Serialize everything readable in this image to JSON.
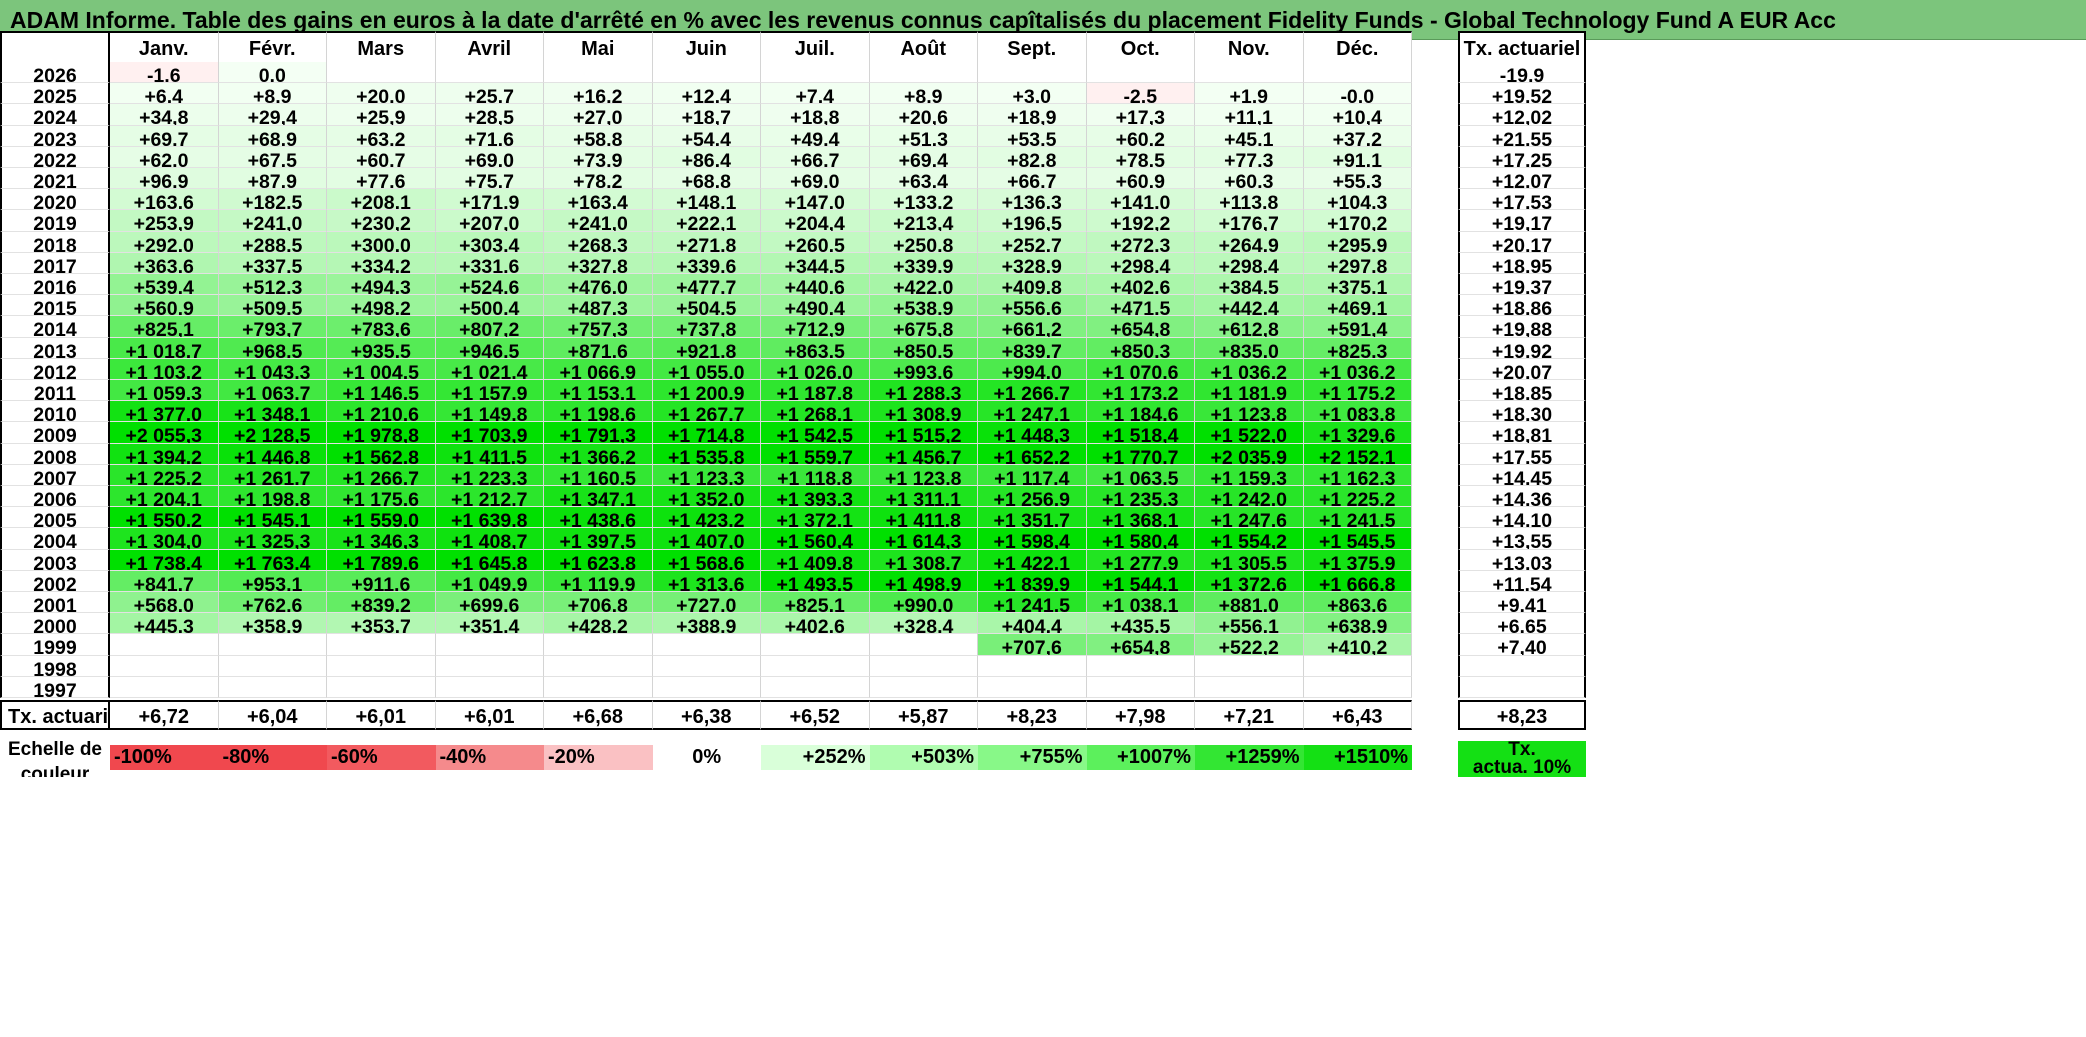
{
  "title": "ADAM Informe. Table des gains en euros à la date d'arrêté en % avec les revenus connus capîtalisés du placement Fidelity Funds - Global Technology Fund A EUR Acc",
  "months": [
    "Janv.",
    "Févr.",
    "Mars",
    "Avril",
    "Mai",
    "Juin",
    "Juil.",
    "Août",
    "Sept.",
    "Oct.",
    "Nov.",
    "Déc."
  ],
  "tx_header": "Tx. actuariel",
  "rows": [
    {
      "year": "2026",
      "values": [
        "-1,6",
        "0,0",
        "",
        "",
        "",
        "",
        "",
        "",
        "",
        "",
        "",
        ""
      ],
      "tx": "-19,9"
    },
    {
      "year": "2025",
      "values": [
        "+6,4",
        "+8,9",
        "+20,0",
        "+25,7",
        "+16,2",
        "+12,4",
        "+7,4",
        "+8,9",
        "+3,0",
        "-2,5",
        "+1,9",
        "-0,0"
      ],
      "tx": "+19,52"
    },
    {
      "year": "2024",
      "values": [
        "+34,8",
        "+29,4",
        "+25,9",
        "+28,5",
        "+27,0",
        "+18,7",
        "+18,8",
        "+20,6",
        "+18,9",
        "+17,3",
        "+11,1",
        "+10,4"
      ],
      "tx": "+12,02"
    },
    {
      "year": "2023",
      "values": [
        "+69,7",
        "+68,9",
        "+63,2",
        "+71,6",
        "+58,8",
        "+54,4",
        "+49,4",
        "+51,3",
        "+53,5",
        "+60,2",
        "+45,1",
        "+37,2"
      ],
      "tx": "+21,55"
    },
    {
      "year": "2022",
      "values": [
        "+62,0",
        "+67,5",
        "+60,7",
        "+69,0",
        "+73,9",
        "+86,4",
        "+66,7",
        "+69,4",
        "+82,8",
        "+78,5",
        "+77,3",
        "+91,1"
      ],
      "tx": "+17,25"
    },
    {
      "year": "2021",
      "values": [
        "+96,9",
        "+87,9",
        "+77,6",
        "+75,7",
        "+78,2",
        "+68,8",
        "+69,0",
        "+63,4",
        "+66,7",
        "+60,9",
        "+60,3",
        "+55,3"
      ],
      "tx": "+12,07"
    },
    {
      "year": "2020",
      "values": [
        "+163,6",
        "+182,5",
        "+208,1",
        "+171,9",
        "+163,4",
        "+148,1",
        "+147,0",
        "+133,2",
        "+136,3",
        "+141,0",
        "+113,8",
        "+104,3"
      ],
      "tx": "+17,53"
    },
    {
      "year": "2019",
      "values": [
        "+253,9",
        "+241,0",
        "+230,2",
        "+207,0",
        "+241,0",
        "+222,1",
        "+204,4",
        "+213,4",
        "+196,5",
        "+192,2",
        "+176,7",
        "+170,2"
      ],
      "tx": "+19,17"
    },
    {
      "year": "2018",
      "values": [
        "+292,0",
        "+288,5",
        "+300,0",
        "+303,4",
        "+268,3",
        "+271,8",
        "+260,5",
        "+250,8",
        "+252,7",
        "+272,3",
        "+264,9",
        "+295,9"
      ],
      "tx": "+20,17"
    },
    {
      "year": "2017",
      "values": [
        "+363,6",
        "+337,5",
        "+334,2",
        "+331,6",
        "+327,8",
        "+339,6",
        "+344,5",
        "+339,9",
        "+328,9",
        "+298,4",
        "+298,4",
        "+297,8"
      ],
      "tx": "+18,95"
    },
    {
      "year": "2016",
      "values": [
        "+539,4",
        "+512,3",
        "+494,3",
        "+524,6",
        "+476,0",
        "+477,7",
        "+440,6",
        "+422,0",
        "+409,8",
        "+402,6",
        "+384,5",
        "+375,1"
      ],
      "tx": "+19,37"
    },
    {
      "year": "2015",
      "values": [
        "+560,9",
        "+509,5",
        "+498,2",
        "+500,4",
        "+487,3",
        "+504,5",
        "+490,4",
        "+538,9",
        "+556,6",
        "+471,5",
        "+442,4",
        "+469,1"
      ],
      "tx": "+18,86"
    },
    {
      "year": "2014",
      "values": [
        "+825,1",
        "+793,7",
        "+783,6",
        "+807,2",
        "+757,3",
        "+737,8",
        "+712,9",
        "+675,8",
        "+661,2",
        "+654,8",
        "+612,8",
        "+591,4"
      ],
      "tx": "+19,88"
    },
    {
      "year": "2013",
      "values": [
        "+1 018,7",
        "+968,5",
        "+935,5",
        "+946,5",
        "+871,6",
        "+921,8",
        "+863,5",
        "+850,5",
        "+839,7",
        "+850,3",
        "+835,0",
        "+825,3"
      ],
      "tx": "+19,92"
    },
    {
      "year": "2012",
      "values": [
        "+1 103,2",
        "+1 043,3",
        "+1 004,5",
        "+1 021,4",
        "+1 066,9",
        "+1 055,0",
        "+1 026,0",
        "+993,6",
        "+994,0",
        "+1 070,6",
        "+1 036,2",
        "+1 036,2"
      ],
      "tx": "+20,07"
    },
    {
      "year": "2011",
      "values": [
        "+1 059,3",
        "+1 063,7",
        "+1 146,5",
        "+1 157,9",
        "+1 153,1",
        "+1 200,9",
        "+1 187,8",
        "+1 288,3",
        "+1 266,7",
        "+1 173,2",
        "+1 181,9",
        "+1 175,2"
      ],
      "tx": "+18,85"
    },
    {
      "year": "2010",
      "values": [
        "+1 377,0",
        "+1 348,1",
        "+1 210,6",
        "+1 149,8",
        "+1 198,6",
        "+1 267,7",
        "+1 268,1",
        "+1 308,9",
        "+1 247,1",
        "+1 184,6",
        "+1 123,8",
        "+1 083,8"
      ],
      "tx": "+18,30"
    },
    {
      "year": "2009",
      "values": [
        "+2 055,3",
        "+2 128,5",
        "+1 978,8",
        "+1 703,9",
        "+1 791,3",
        "+1 714,8",
        "+1 542,5",
        "+1 515,2",
        "+1 448,3",
        "+1 518,4",
        "+1 522,0",
        "+1 329,6"
      ],
      "tx": "+18,81"
    },
    {
      "year": "2008",
      "values": [
        "+1 394,2",
        "+1 446,8",
        "+1 562,8",
        "+1 411,5",
        "+1 366,2",
        "+1 535,8",
        "+1 559,7",
        "+1 456,7",
        "+1 652,2",
        "+1 770,7",
        "+2 035,9",
        "+2 152,1"
      ],
      "tx": "+17,55"
    },
    {
      "year": "2007",
      "values": [
        "+1 225,2",
        "+1 261,7",
        "+1 266,7",
        "+1 223,3",
        "+1 160,5",
        "+1 123,3",
        "+1 118,8",
        "+1 123,8",
        "+1 117,4",
        "+1 063,5",
        "+1 159,3",
        "+1 162,3"
      ],
      "tx": "+14,45"
    },
    {
      "year": "2006",
      "values": [
        "+1 204,1",
        "+1 198,8",
        "+1 175,6",
        "+1 212,7",
        "+1 347,1",
        "+1 352,0",
        "+1 393,3",
        "+1 311,1",
        "+1 256,9",
        "+1 235,3",
        "+1 242,0",
        "+1 225,2"
      ],
      "tx": "+14,36"
    },
    {
      "year": "2005",
      "values": [
        "+1 550,2",
        "+1 545,1",
        "+1 559,0",
        "+1 639,8",
        "+1 438,6",
        "+1 423,2",
        "+1 372,1",
        "+1 411,8",
        "+1 351,7",
        "+1 368,1",
        "+1 247,6",
        "+1 241,5"
      ],
      "tx": "+14,10"
    },
    {
      "year": "2004",
      "values": [
        "+1 304,0",
        "+1 325,3",
        "+1 346,3",
        "+1 408,7",
        "+1 397,5",
        "+1 407,0",
        "+1 560,4",
        "+1 614,3",
        "+1 598,4",
        "+1 580,4",
        "+1 554,2",
        "+1 545,5"
      ],
      "tx": "+13,55"
    },
    {
      "year": "2003",
      "values": [
        "+1 738,4",
        "+1 763,4",
        "+1 789,6",
        "+1 645,8",
        "+1 623,8",
        "+1 568,6",
        "+1 409,8",
        "+1 308,7",
        "+1 422,1",
        "+1 277,9",
        "+1 305,5",
        "+1 375,9"
      ],
      "tx": "+13,03"
    },
    {
      "year": "2002",
      "values": [
        "+841,7",
        "+953,1",
        "+911,6",
        "+1 049,9",
        "+1 119,9",
        "+1 313,6",
        "+1 493,5",
        "+1 498,9",
        "+1 839,9",
        "+1 544,1",
        "+1 372,6",
        "+1 666,8"
      ],
      "tx": "+11,54"
    },
    {
      "year": "2001",
      "values": [
        "+568,0",
        "+762,6",
        "+839,2",
        "+699,6",
        "+706,8",
        "+727,0",
        "+825,1",
        "+990,0",
        "+1 241,5",
        "+1 038,1",
        "+881,0",
        "+863,6"
      ],
      "tx": "+9,41"
    },
    {
      "year": "2000",
      "values": [
        "+445,3",
        "+358,9",
        "+353,7",
        "+351,4",
        "+428,2",
        "+388,9",
        "+402,6",
        "+328,4",
        "+404,4",
        "+435,5",
        "+556,1",
        "+638,9"
      ],
      "tx": "+6,65"
    },
    {
      "year": "1999",
      "values": [
        "",
        "",
        "",
        "",
        "",
        "",
        "",
        "",
        "+707,6",
        "+654,8",
        "+522,2",
        "+410,2"
      ],
      "tx": "+7,40"
    },
    {
      "year": "1998",
      "values": [
        "",
        "",
        "",
        "",
        "",
        "",
        "",
        "",
        "",
        "",
        "",
        ""
      ],
      "tx": ""
    },
    {
      "year": "1997",
      "values": [
        "",
        "",
        "",
        "",
        "",
        "",
        "",
        "",
        "",
        "",
        "",
        ""
      ],
      "tx": ""
    }
  ],
  "footer": {
    "label": "Tx. actuariel",
    "values": [
      "+6,72",
      "+6,04",
      "+6,01",
      "+6,01",
      "+6,68",
      "+6,38",
      "+6,52",
      "+5,87",
      "+8,23",
      "+7,98",
      "+7,21",
      "+6,43"
    ],
    "tx": "+8,23"
  },
  "scale": {
    "label_line1": "Echelle de",
    "label_line2": "couleur",
    "steps": [
      {
        "label": "-100%",
        "color": "#f0484e"
      },
      {
        "label": "-80%",
        "color": "#f0484e"
      },
      {
        "label": "-60%",
        "color": "#f25a5f"
      },
      {
        "label": "-40%",
        "color": "#f58a8c"
      },
      {
        "label": "-20%",
        "color": "#fac1c3"
      },
      {
        "label": "0%",
        "color": "#ffffff"
      },
      {
        "label": "+252%",
        "color": "#d9ffd9"
      },
      {
        "label": "+503%",
        "color": "#b0fcb0"
      },
      {
        "label": "+755%",
        "color": "#88f888"
      },
      {
        "label": "+1007%",
        "color": "#5cf05c"
      },
      {
        "label": "+1259%",
        "color": "#33e633"
      },
      {
        "label": "+1510%",
        "color": "#14e014"
      }
    ],
    "tx_label_line1": "Tx.",
    "tx_label_line2": "actua. 10%",
    "tx_color": "#14e014"
  },
  "colors": {
    "title_bg": "#7cc57c",
    "negative_tint": "#fff0f0",
    "max_green": "#00e000"
  }
}
